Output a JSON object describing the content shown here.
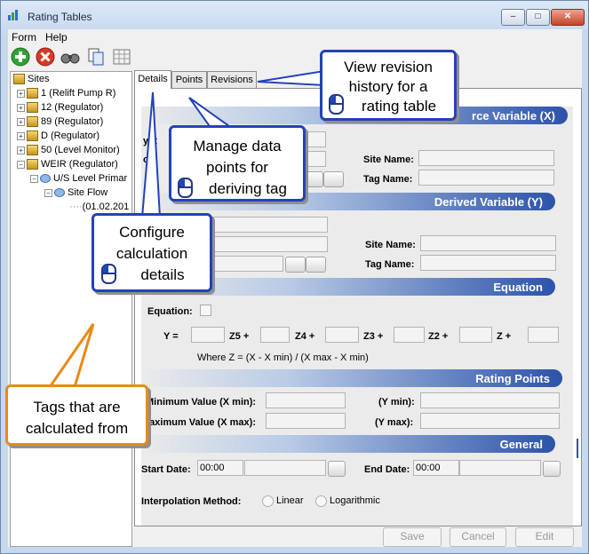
{
  "window": {
    "title": "Rating Tables",
    "buttons": {
      "minimize": "–",
      "maximize": "□",
      "close": "✕"
    }
  },
  "menu": [
    "Form",
    "Help"
  ],
  "toolbar": {
    "icons": [
      "add-icon",
      "delete-icon",
      "binoculars-icon",
      "copy-icon",
      "grid-icon"
    ]
  },
  "tree": {
    "root": "Sites",
    "items": [
      {
        "label": "1 (Relift Pump R)"
      },
      {
        "label": "12 (Regulator)"
      },
      {
        "label": "89 (Regulator)"
      },
      {
        "label": "D (Regulator)"
      },
      {
        "label": "50 (Level Monitor)"
      },
      {
        "label": "WEIR (Regulator)"
      }
    ],
    "child1": "U/S Level Primar",
    "child2": "Site Flow",
    "child3": "(01.02.201"
  },
  "tabs": [
    "Details",
    "Points",
    "Revisions"
  ],
  "source": {
    "header": "rce Variable (X)",
    "partial_label1": "yst",
    "partial_label2": "ou",
    "site_name_label": "Site Name:",
    "tag_name_label": "Tag Name:"
  },
  "derived": {
    "header": "Derived Variable (Y)",
    "site_name_label": "Site Name:",
    "tag_name_label": "Tag Name:"
  },
  "equation": {
    "header": "Equation",
    "checkbox_label": "Equation:",
    "y_label": "Y =",
    "terms": [
      "Z5 +",
      "Z4 +",
      "Z3 +",
      "Z2 +",
      "Z +"
    ],
    "where": "Where Z = (X - X min) / (X max - X min)"
  },
  "rating_points": {
    "header": "Rating Points",
    "xmin_label": "Minimum Value (X min):",
    "xmax_label": "Maximum Value (X max):",
    "ymin_label": "(Y min):",
    "ymax_label": "(Y max):"
  },
  "general": {
    "header": "General",
    "start_label": "Start Date:",
    "start_value": "00:00",
    "end_label": "End Date:",
    "end_value": "00:00",
    "interp_label": "Interpolation Method:",
    "option_linear": "Linear",
    "option_log": "Logarithmic"
  },
  "buttons": {
    "save": "Save",
    "cancel": "Cancel",
    "edit": "Edit"
  },
  "callouts": {
    "revisions": [
      "View revision",
      "history for a",
      "rating table"
    ],
    "points": [
      "Manage data",
      "points for",
      "deriving tag"
    ],
    "details": [
      "Configure",
      "calculation",
      "details"
    ],
    "tags": [
      "Tags that are",
      "calculated from"
    ]
  }
}
